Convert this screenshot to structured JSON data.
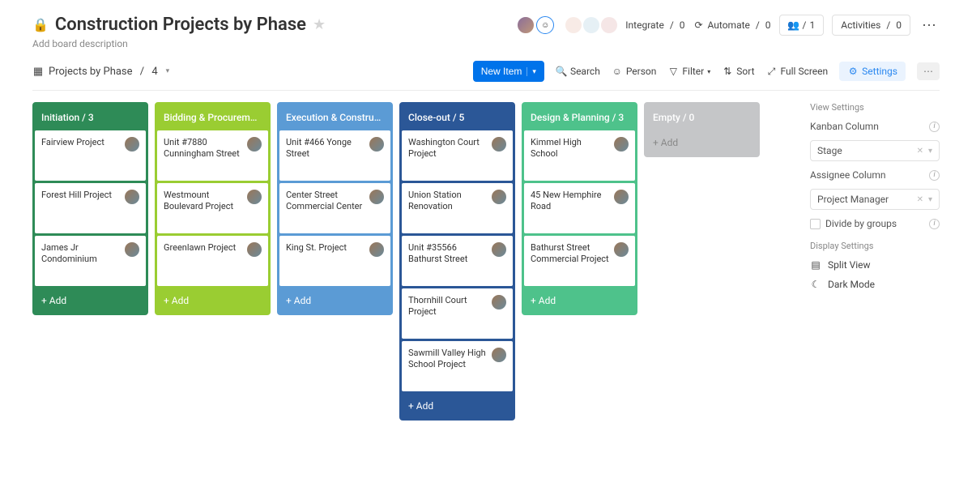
{
  "header": {
    "title": "Construction Projects by Phase",
    "description": "Add board description",
    "integrate": {
      "label": "Integrate",
      "count": 0
    },
    "automate": {
      "label": "Automate",
      "count": 0
    },
    "members_count": 1,
    "activities": {
      "label": "Activities",
      "count": 0
    }
  },
  "toolbar": {
    "view_name": "Projects by Phase",
    "view_count": 4,
    "new_item": "New Item",
    "search": "Search",
    "person": "Person",
    "filter": "Filter",
    "sort": "Sort",
    "full_screen": "Full Screen",
    "settings": "Settings"
  },
  "columns": [
    {
      "name": "Initiation",
      "count": 3,
      "color": "#2e8b57",
      "cards": [
        {
          "title": "Fairview Project"
        },
        {
          "title": "Forest Hill Project"
        },
        {
          "title": "James Jr Condominium"
        }
      ]
    },
    {
      "name": "Bidding & Procurement",
      "count": 3,
      "color": "#9acd32",
      "cards": [
        {
          "title": "Unit #7880 Cunningham Street"
        },
        {
          "title": "Westmount Boulevard Project"
        },
        {
          "title": "Greenlawn Project"
        }
      ]
    },
    {
      "name": "Execution & Constructio...",
      "count": null,
      "color": "#5b9bd5",
      "cards": [
        {
          "title": "Unit #466 Yonge Street"
        },
        {
          "title": "Center Street Commercial Center"
        },
        {
          "title": "King St. Project"
        }
      ]
    },
    {
      "name": "Close-out",
      "count": 5,
      "color": "#2b5797",
      "cards": [
        {
          "title": "Washington Court Project"
        },
        {
          "title": "Union Station Renovation"
        },
        {
          "title": "Unit #35566 Bathurst Street"
        },
        {
          "title": "Thornhill Court Project"
        },
        {
          "title": "Sawmill Valley High School Project"
        }
      ]
    },
    {
      "name": "Design & Planning",
      "count": 3,
      "color": "#4ec28b",
      "cards": [
        {
          "title": "Kimmel High School"
        },
        {
          "title": "45 New Hemphire Road"
        },
        {
          "title": "Bathurst Street Commercial Project"
        }
      ]
    },
    {
      "name": "Empty",
      "count": 0,
      "color": "#c5c6c8",
      "cards": []
    }
  ],
  "add_label": "+ Add",
  "settings_panel": {
    "view_settings": "View Settings",
    "kanban_column": "Kanban Column",
    "kanban_value": "Stage",
    "assignee_column": "Assignee Column",
    "assignee_value": "Project Manager",
    "divide_groups": "Divide by groups",
    "display_settings": "Display Settings",
    "split_view": "Split View",
    "dark_mode": "Dark Mode"
  }
}
